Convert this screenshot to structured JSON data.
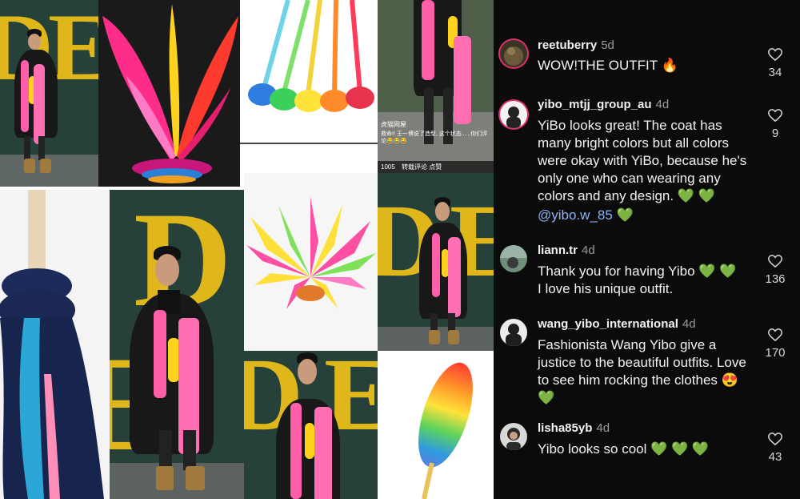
{
  "collage": {
    "phone_username": "虎猫网屋",
    "phone_caption": "救命!! 王一博说了造型, 这个状态......你们评论😂😂😂",
    "phone_footer": "1005",
    "phone_footer_extra": "转载评论 点赞"
  },
  "comments": [
    {
      "username": "reetuberry",
      "age": "5d",
      "text": "WOW!THE OUTFIT",
      "emoji": "🔥",
      "likes": "34"
    },
    {
      "username": "yibo_mtjj_group_au",
      "age": "4d",
      "text": "YiBo looks great! The coat has many bright colors but all colors were okay with YiBo, because he's only one who can wearing any colors and any design.",
      "emoji": "💚 💚",
      "mention": "@yibo.w_85",
      "mention_emoji": "💚",
      "likes": "9"
    },
    {
      "username": "liann.tr",
      "age": "4d",
      "text_line1": "Thank you for having Yibo",
      "text_line1_emoji": "💚 💚",
      "text_line2": "I love his unique outfit.",
      "likes": "136"
    },
    {
      "username": "wang_yibo_international",
      "age": "4d",
      "text": "Fashionista Wang Yibo give a justice to the beautiful outfits. Love to see him rocking the clothes",
      "emoji": "😍 💚",
      "likes": "170"
    },
    {
      "username": "lisha85yb",
      "age": "4d",
      "text": "Yibo looks so cool",
      "emoji": "💚 💚 💚",
      "likes": "43"
    }
  ]
}
